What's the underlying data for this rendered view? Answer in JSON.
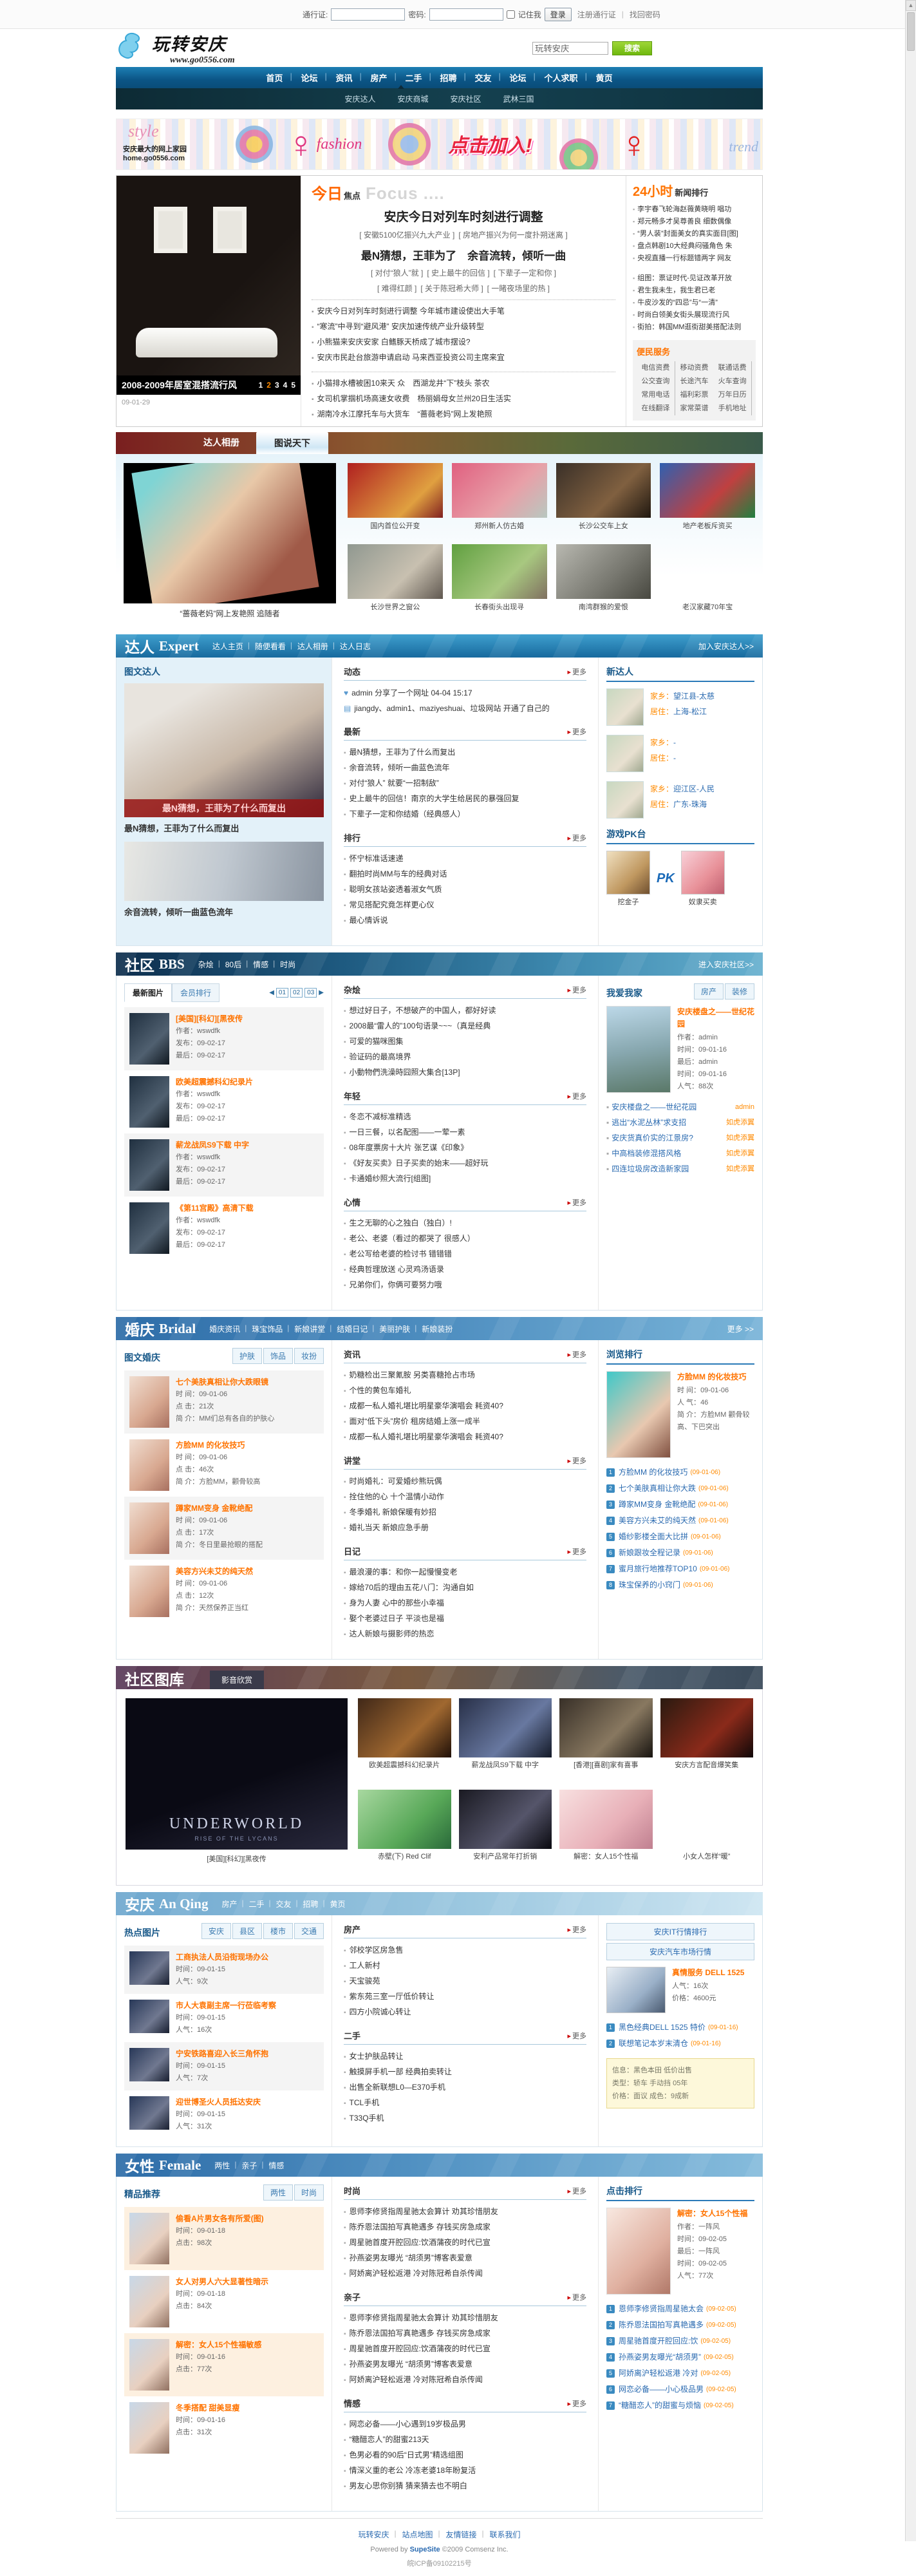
{
  "ui": {
    "more": "更多",
    "pk": "PK",
    "prev": "◀",
    "next": "▶"
  },
  "topbar": {
    "passport_label": "通行证:",
    "password_label": "密码:",
    "remember_label": "记住我",
    "login_button": "登录",
    "register_link": "注册通行证",
    "forgot_link": "找回密码",
    "sep": "|"
  },
  "header": {
    "site_name": "玩转安庆",
    "site_url": "www.go0556.com",
    "search_value": "玩转安庆",
    "search_button": "搜索"
  },
  "nav": {
    "items": [
      "首页",
      "论坛",
      "资讯",
      "房产",
      "二手",
      "招聘",
      "交友",
      "论坛",
      "个人求职",
      "黄页"
    ],
    "sub_items": [
      "安庆达人",
      "安庆商城",
      "安庆社区",
      "武林三国"
    ]
  },
  "banner": {
    "style_text": "style",
    "fashion_text": "fashion",
    "join_text": "点击加入!",
    "trend_text": "trend",
    "home_line1": "安庆最大的网上家园",
    "home_line2": "home.go0556.com",
    "sil1": "♀",
    "sil2": "♀"
  },
  "focus": {
    "title_orange": "今日",
    "title_black": "焦点",
    "title_en": "Focus ....",
    "carousel_caption": "2008-2009年居室混搭流行风",
    "pager": [
      "1",
      "2",
      "3",
      "4",
      "5"
    ],
    "date": "09-01-29",
    "headline": "安庆今日对列车时刻进行调整",
    "sub1": [
      "[ 安徽5100亿振兴九大产业 ]",
      "[ 房地产振兴为何一度扑朔迷离 ]"
    ],
    "headline2": "最N猜想，王菲为了　余音流转，倾听一曲",
    "sub2": [
      "[ 对付“狼人”就 ]",
      "[ 史上最牛的回信 ]",
      "[ 下辈子一定和你 ]"
    ],
    "sub3": [
      "[ 难得红颜 ]",
      "[ 关于陈冠希大师 ]",
      "[ 一睹夜场里的热 ]"
    ],
    "list1": [
      "安庆今日对列车时刻进行调整 今年城市建设使出大手笔",
      "“寒流”中寻到“避风港” 安庆加速传统产业升级转型",
      "小熊猫来安庆安家 白鳍豚天桥成了城市摆设?",
      "安庆市民赴台旅游申请启动 马来西亚投资公司主席来宜"
    ],
    "list2": [
      "小猫排水槽被困10来天 众　西湖龙井“下”枝头 茶农",
      "女司机掌掴机场高速女收费　杨丽娟母女兰州20日生活实",
      "湖南冷水江摩托车与大货车　“蔷薇老妈”网上发艳照"
    ]
  },
  "hours24": {
    "title_orange": "24小时",
    "title_black": "新闻排行",
    "list1": [
      "李宇春飞轮海赵薇黄晓明 唱功",
      "郑元畅多才吴尊善良 细数偶像",
      "“男人装”封面美女的真实面目[图]",
      "盘点韩剧10大经典闷骚角色 朱",
      "央视直播一行标题错两字 网友"
    ],
    "list2": [
      "组图：票证时代-见证改革开放",
      "君生我未生，我生君已老",
      "牛皮沙发的“四忌”与“一清”",
      "时尚白领美女街头展现流行风",
      "街拍：韩国MM逛街甜美搭配法则"
    ]
  },
  "services": {
    "title": "便民服务",
    "links": [
      "电信资费",
      "移动资费",
      "联通话费",
      "公交查询",
      "长途汽车",
      "火车查询",
      "常用电话",
      "福利彩票",
      "万年日历",
      "在线翻译",
      "家常菜谱",
      "手机地址"
    ]
  },
  "photostrip": {
    "tab_active": "达人相册",
    "tab_inactive": "图说天下",
    "big_caption": "“蔷薇老妈”网上发艳照 追随者",
    "captions": [
      "国内首位公开变",
      "郑州新人仿古婚",
      "长沙公交车上女",
      "地产老板斥资买",
      "长沙世界之窗公",
      "长春街头出现寻",
      "南湾群猴的爱恨",
      "老汉家藏70年宝"
    ]
  },
  "expert": {
    "title_cn": "达人",
    "title_en": "Expert",
    "menu": [
      "达人主页",
      "随便看看",
      "达人相册",
      "达人日志"
    ],
    "enter_link": "加入安庆达人>>",
    "left": {
      "title": "图文达人",
      "feat1_overlay": "最N猜想，王菲为了什么而复出",
      "feat1_caption": "最N猜想，王菲为了什么而复出",
      "feat2_caption": "余音流转，倾听一曲蓝色流年"
    },
    "center": {
      "sec1_title": "动态",
      "dyn_items": [
        {
          "icon": "♥",
          "text": "admin 分享了一个网址 04-04 15:17"
        },
        {
          "icon": "▤",
          "text": "jiangdy、admin1、maziyeshuai、垃圾网站 开通了自己的"
        }
      ],
      "sec2_title": "最新",
      "latest_items": [
        "最N猜想，王菲为了什么而复出",
        "余音流转，倾听一曲蓝色流年",
        "对付“狼人” 就要“一招制敌”",
        "史上最牛的回信！南京的大学生给居民的暴强回复",
        "下辈子一定和你结婚（经典感人）"
      ],
      "sec3_title": "排行",
      "rank_items": [
        "怀宁标准话速递",
        "翻拍时尚MM与车的经典对话",
        "聪明女孩站姿透着淑女气质",
        "常见搭配究竟怎样更心仪",
        "最心情诉说"
      ]
    },
    "right": {
      "newbies_title": "新达人",
      "labels": {
        "hometown": "家乡：",
        "live": "居住："
      },
      "newbies": [
        {
          "hometown": "望江县-太慈",
          "live": "上海-松江"
        },
        {
          "hometown": "-",
          "live": "-"
        },
        {
          "hometown": "迎江区-人民",
          "live": "广东-珠海"
        }
      ],
      "pk_title": "游戏PK台",
      "pk_left": "挖金子",
      "pk_right": "奴隶买卖"
    }
  },
  "bbs": {
    "title_cn": "社区",
    "title_en": "BBS",
    "menu": [
      "杂烩",
      "80后",
      "情感",
      "时尚"
    ],
    "enter_link": "进入安庆社区>>",
    "left": {
      "tab1": "最新图片",
      "tab2": "会员排行",
      "pages": [
        "01",
        "02",
        "03"
      ],
      "labels": {
        "author": "作者：",
        "pub": "发布：",
        "last": "最后："
      },
      "items": [
        {
          "title": "[美国][科幻][黑夜传",
          "author": "wswdfk",
          "pub": "09-02-17",
          "last": "09-02-17"
        },
        {
          "title": "欧美超震撼科幻纪录片",
          "author": "wswdfk",
          "pub": "09-02-17",
          "last": "09-02-17"
        },
        {
          "title": "薪龙战凤S9下载 中字",
          "author": "wswdfk",
          "pub": "09-02-17",
          "last": "09-02-17"
        },
        {
          "title": "《第11宫殿》高清下载",
          "author": "wswdfk",
          "pub": "09-02-17",
          "last": "09-02-17"
        }
      ]
    },
    "center": {
      "sec1_title": "杂烩",
      "sec1_items": [
        "想过好日子，不想破产的中国人，都好好读",
        "2008最“雷人的”100句语录~~~（真是经典",
        "可爱的猫咪图集",
        "验证码的最高境界",
        "小動物們洗澡時囧照大集合[13P]"
      ],
      "sec2_title": "年轻",
      "sec2_items": [
        "冬恋不减标准精选",
        "一日三餐，以名配图——一荤一素",
        "08年度票房十大片 张艺谋《印象》",
        "《好友买卖》日子买卖的始末——超好玩",
        "卡通婚纱照大流行[组图]"
      ],
      "sec3_title": "心情",
      "sec3_items": [
        "生之无聊的心之独白（独白）!",
        "老公、老婆（看过的都哭了 很感人）",
        "老公写给老婆的检讨书 错错错",
        "经典哲理放送 心灵鸡汤语录",
        "兄弟你们，你俩可要努力哦"
      ]
    },
    "right": {
      "title": "我爱我家",
      "tab1": "房产",
      "tab2": "装修",
      "feat": {
        "title": "安庆楼盘之——世纪花园",
        "author_label": "作者：",
        "author": "admin",
        "time_label": "时间：",
        "time": "09-01-16",
        "last_label": "最后：",
        "last": "admin",
        "time2": "09-01-16",
        "hits_label": "人气：",
        "hits": "88次"
      },
      "list": [
        {
          "text": "安庆楼盘之——世纪花园",
          "by": "admin"
        },
        {
          "text": "逃出“水泥丛林”求支招",
          "by": "如虎添翼"
        },
        {
          "text": "安庆货真价实的江景房?",
          "by": "如虎添翼"
        },
        {
          "text": "中高档装修混搭风格",
          "by": "如虎添翼"
        },
        {
          "text": "四连垃圾房改造新家园",
          "by": "如虎添翼"
        }
      ]
    }
  },
  "bridal": {
    "title_cn": "婚庆",
    "title_en": "Bridal",
    "menu": [
      "婚庆资讯",
      "珠宝饰品",
      "新娘讲堂",
      "结婚日记",
      "美丽护肤",
      "新娘装扮"
    ],
    "more_link": "更多 >>",
    "left": {
      "title": "图文婚庆",
      "tabs": [
        "护肤",
        "饰品",
        "妆扮"
      ],
      "labels": {
        "time": "时 间：",
        "hits": "点 击：",
        "intro": "简 介："
      },
      "items": [
        {
          "title": "七个美肤真相让你大跌眼镜",
          "time": "09-01-06",
          "hits": "21次",
          "intro": "MM们总有各自的护肤心"
        },
        {
          "title": "方脸MM 的化妆技巧",
          "time": "09-01-06",
          "hits": "46次",
          "intro": "方脸MM，颧骨较高"
        },
        {
          "title": "蹲家MM变身 金靴绝配",
          "time": "09-01-06",
          "hits": "17次",
          "intro": "冬日里最抢眼的搭配"
        },
        {
          "title": "美容方兴未艾的纯天然",
          "time": "09-01-06",
          "hits": "12次",
          "intro": "天然保养正当红"
        }
      ]
    },
    "center": {
      "sec1_title": "资讯",
      "sec1_items": [
        "奶糖检出三聚氰胺 另类喜糖抢占市场",
        "个性的黄包车婚礼",
        "成都一私人婚礼堪比明星豪华演唱会 耗资40?",
        "面对“低下头”房价 租房结婚上涨一成半",
        "成都一私人婚礼堪比明星豪华演唱会 耗资40?"
      ],
      "sec2_title": "讲堂",
      "sec2_items": [
        "时尚婚礼：可爱婚纱熊玩偶",
        "拴住他的心 十个温情小动作",
        "冬季婚礼 新娘保暖有妙招",
        "婚礼当天 新娘应急手册"
      ],
      "sec3_title": "日记",
      "sec3_items": [
        "最浪漫的事：和你一起慢慢变老",
        "嫁给70后的理由五花八门：沟通自如",
        "身为人妻 心中的那些小幸福",
        "娶个老婆过日子 平淡也是福",
        "达人新娘与摄影师的热恋"
      ]
    },
    "right": {
      "title": "浏览排行",
      "feat": {
        "title": "方脸MM 的化妆技巧",
        "time_label": "时 间：",
        "time": "09-01-06",
        "hits_label": "人 气：",
        "hits": "46",
        "intro_label": "简 介：",
        "intro": "方脸MM 颧骨较高、下巴突出"
      },
      "list": [
        {
          "text": "方脸MM 的化妆技巧",
          "date": "(09-01-06)"
        },
        {
          "text": "七个美肤真相让你大跌",
          "date": "(09-01-06)"
        },
        {
          "text": "蹲家MM变身 金靴绝配",
          "date": "(09-01-06)"
        },
        {
          "text": "美容方兴未艾的纯天然",
          "date": "(09-01-06)"
        },
        {
          "text": "婚纱影楼全面大比拼",
          "date": "(09-01-06)"
        },
        {
          "text": "新娘跟妆全程记录",
          "date": "(09-01-06)"
        },
        {
          "text": "蜜月旅行地推荐TOP10",
          "date": "(09-01-06)"
        },
        {
          "text": "珠宝保养的小窍门",
          "date": "(09-01-06)"
        }
      ]
    }
  },
  "gallery": {
    "title": "社区图库",
    "tab": "影音欣赏",
    "big_text": "UNDERWORLD",
    "big_sub": "RISE OF THE LYCANS",
    "big_caption": "[美国][科幻][黑夜传",
    "captions": [
      "欧美超震撼科幻纪录片",
      "薪龙战凤S9下载 中字",
      "[香港][喜剧]家有喜事",
      "安庆方言配音爆笑集",
      "赤壁(下) Red Clif",
      "安利产品常年打折销",
      "解密：女人15个性福",
      "小女人怎样“暖”"
    ]
  },
  "anqing": {
    "title_cn": "安庆",
    "title_en": "An Qing",
    "menu": [
      "房产",
      "二手",
      "交友",
      "招聘",
      "黄页"
    ],
    "left": {
      "title": "热点图片",
      "tabs": [
        "安庆",
        "县区",
        "楼市",
        "交通"
      ],
      "labels": {
        "time": "时间：",
        "hits": "人气："
      },
      "items": [
        {
          "title": "工商执法人员沿街现场办公",
          "time": "09-01-15",
          "hits": "9次"
        },
        {
          "title": "市人大袁副主席一行莅临考察",
          "time": "09-01-15",
          "hits": "16次"
        },
        {
          "title": "宁安铁路喜迎入长三角怀抱",
          "time": "09-01-15",
          "hits": "7次"
        },
        {
          "title": "迎世博圣火人员抵达安庆",
          "time": "09-01-15",
          "hits": "31次"
        }
      ]
    },
    "center": {
      "sec1_title": "房产",
      "sec1_items": [
        "邻校学区房急售",
        "工人新村",
        "天宝骏苑",
        "紫东苑三室一厅低价转让",
        "四方小院诚心转让"
      ],
      "sec2_title": "二手",
      "sec2_items": [
        "女士护肤品转让",
        "触摸屏手机一部 经典拍卖转让",
        "出售全新联想L0—E370手机",
        "TCL手机",
        "T33Q手机"
      ]
    },
    "right": {
      "tab1": "安庆IT行情排行",
      "tab2": "安庆汽车市场行情",
      "feat": {
        "title": "真情服务 DELL 1525",
        "hits_label": "人气：",
        "hits": "16次",
        "price_label": "价格：",
        "price": "4600元"
      },
      "list": [
        {
          "text": "黑色经典DELL 1525 特价",
          "date": "(09-01-16)"
        },
        {
          "text": "联想笔记本岁末清仓",
          "date": "(09-01-16)"
        }
      ],
      "notice_rows": [
        "信息：黑色本田 低价出售",
        "类型：轿车 手动挡 05年",
        "价格：面议 成色：9成新"
      ]
    }
  },
  "female": {
    "title_cn": "女性",
    "title_en": "Female",
    "menu": [
      "两性",
      "亲子",
      "情感"
    ],
    "left": {
      "title": "精品推荐",
      "tabs": [
        "两性",
        "时尚"
      ],
      "labels": {
        "time": "时间：",
        "hits": "点击："
      },
      "items": [
        {
          "title": "偷看A片男女各有所爱(图)",
          "time": "09-01-18",
          "hits": "98次"
        },
        {
          "title": "女人对男人六大显著性暗示",
          "time": "09-01-18",
          "hits": "84次"
        },
        {
          "title": "解密：女人15个性福敏感",
          "time": "09-01-16",
          "hits": "77次"
        },
        {
          "title": "冬季搭配 甜美显瘦",
          "time": "09-01-16",
          "hits": "31次"
        }
      ]
    },
    "center": {
      "sec1_title": "时尚",
      "sec1_items": [
        "恩师李修贤指周星驰太会算计 劝其珍惜朋友",
        "陈乔恩法国拍写真艳遇多 存钱买房急成家",
        "周星驰首度开腔回应:饮酒蒲夜的时代已宣",
        "孙燕姿男友曝光 “胡须男”博客表爱意",
        "阿娇离沪轻松返港 冷对陈冠希自杀传闻"
      ],
      "sec2_title": "亲子",
      "sec2_items": [
        "恩师李修贤指周星驰太会算计 劝其珍惜朋友",
        "陈乔恩法国拍写真艳遇多 存钱买房急成家",
        "周星驰首度开腔回应:饮酒蒲夜的时代已宣",
        "孙燕姿男友曝光 “胡须男”博客表爱意",
        "阿娇离沪轻松返港 冷对陈冠希自杀传闻"
      ],
      "sec3_title": "情感",
      "sec3_items": [
        "网恋必备——小心遇到19岁极品男",
        "“糖醋恋人”的甜蜜213天",
        "色男必看的90后“日式男”精选组图",
        "情深义重的老公 冷冻老婆18年盼复活",
        "男友心思你别猜 猜来猜去也不明白"
      ]
    },
    "right": {
      "title": "点击排行",
      "feat": {
        "title": "解密：女人15个性福",
        "author_label": "作者：",
        "author": "一阵风",
        "time_label": "时间：",
        "time": "09-02-05",
        "last_label": "最后：",
        "last": "一阵风",
        "time2": "09-02-05",
        "hits_label": "人气：",
        "hits": "77次"
      },
      "list": [
        {
          "text": "恩师李修贤指周星驰太会",
          "date": "(09-02-05)"
        },
        {
          "text": "陈乔恩法国拍写真艳遇多",
          "date": "(09-02-05)"
        },
        {
          "text": "周星驰首度开腔回应:饮",
          "date": "(09-02-05)"
        },
        {
          "text": "孙燕姿男友曝光“胡须男”",
          "date": "(09-02-05)"
        },
        {
          "text": "阿娇离沪轻松返港 冷对",
          "date": "(09-02-05)"
        },
        {
          "text": "网恋必备——小心极品男",
          "date": "(09-02-05)"
        },
        {
          "text": "“糖醋恋人”的甜蜜与烦恼",
          "date": "(09-02-05)"
        }
      ]
    }
  },
  "footer": {
    "links": [
      "玩转安庆",
      "站点地图",
      "友情链接",
      "联系我们"
    ],
    "powered_prefix": "Powered by ",
    "powered_brand": "SupeSite",
    "powered_suffix": " ©2009 Comsenz Inc.",
    "icp": "皖ICP备09102215号"
  }
}
